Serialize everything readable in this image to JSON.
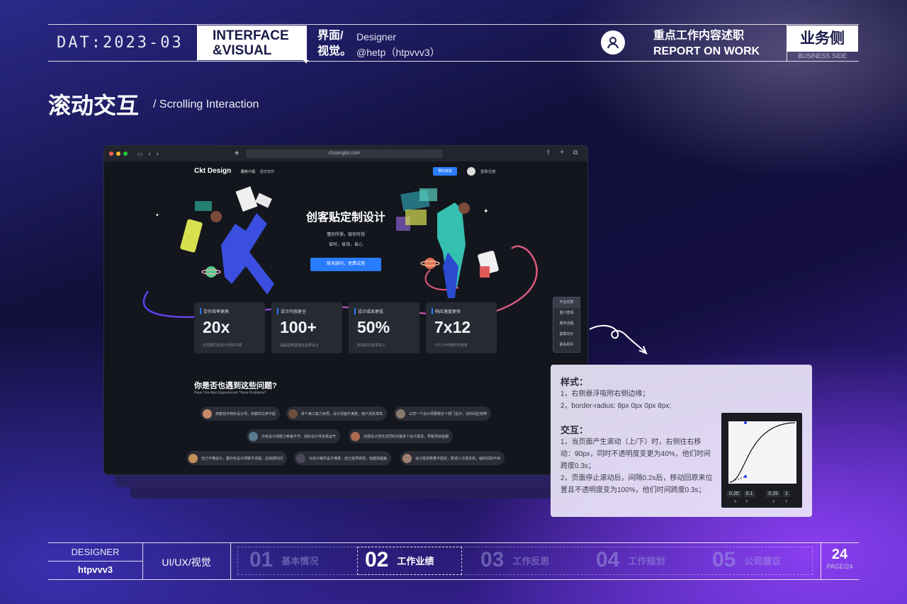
{
  "header": {
    "date": "DAT:2023-03",
    "section_en_1": "INTERFACE",
    "section_en_2": "&VISUAL",
    "section_cn_1": "界面/",
    "section_cn_2": "视觉。",
    "role": "Designer",
    "handle": "@hetp（htpvvv3）",
    "report_cn": "重点工作内容述职",
    "report_en": "REPORT ON WORK",
    "side_cn": "业务侧",
    "side_en": "BUSINESS SIDE"
  },
  "page_title": {
    "cn": "滚动交互",
    "en": "/ Scrolling Interaction"
  },
  "browser": {
    "url": "chuangkit.com",
    "logo": "Ckt Design",
    "nav": [
      "服务介绍",
      "服务案例"
    ],
    "cta": "预约体验",
    "login": "登录/注册",
    "hero_title": "创客贴定制设计",
    "hero_line1": "懂你所需，做你所想",
    "hero_line2": "省时，省钱，省心",
    "hero_button": "联系顾问，免费试用",
    "stats": [
      {
        "label": "交付效率更高",
        "value": "20x",
        "sub": "比招聘内部设计师快20倍"
      },
      {
        "label": "设计内容更全",
        "value": "100+",
        "sub": "涵盖品牌营销全品类设计"
      },
      {
        "label": "设计成本更低",
        "value": "50%",
        "sub": "削减设计成本投入"
      },
      {
        "label": "响应速度更快",
        "value": "7x12",
        "sub": "7X12小时随时可接单"
      }
    ],
    "problems_title": "你是否也遇到这些问题?",
    "problems_sub": "Have You Also Experienced These Problems?",
    "chips": [
      "高薪找不到好设计师，高薪的又养不起",
      "单个美工能力有限，设计页面不满意，用户流失率高",
      "公司一个设计师要做多个部门设计，没时间应变啊",
      "外包设计师能力参差不齐，找好设计师全靠运气",
      "内部设计师无法同时对接多个设计需求，导致项目延期",
      "自己不懂设计，跟外包设计师聊不清楚，还浪费时间",
      "对设计稿件品不满意，自己指导修改，但越改越差",
      "设计需求数量不固定，聘请人才成本高，临时间找不到"
    ],
    "side_nav": [
      "平台优势",
      "客户案例",
      "服务流程",
      "套餐定价",
      "联系顾问"
    ]
  },
  "note": {
    "style_title": "样式：",
    "style_lines": [
      "1，右侧悬浮吸附右侧边缘；",
      "2，border-radius: 8px 0px 0px 8px;"
    ],
    "interact_title": "交互：",
    "interact_lines": [
      "1，当页面产生滚动（上/下）时，右侧往右移",
      "动：90px，同时不透明度变更为40%，他们时间",
      "跨度0.3s；",
      "2，页面停止滚动后，间隔0.2s后，移动回原来位",
      "置且不透明度变为100%，他们时间跨度0.3s；"
    ],
    "curve_values": [
      "0.25",
      "0.1",
      "0.25",
      "1"
    ],
    "curve_axes": [
      "X",
      "Y",
      "X",
      "Y"
    ]
  },
  "footer": {
    "designer": "DESIGNER",
    "handle": "htpvvv3",
    "discipline": "UI/UX/视觉",
    "tabs": [
      {
        "num": "01",
        "label": "基本情况"
      },
      {
        "num": "02",
        "label": "工作业绩"
      },
      {
        "num": "03",
        "label": "工作反思"
      },
      {
        "num": "04",
        "label": "工作规划"
      },
      {
        "num": "05",
        "label": "公司建议"
      }
    ],
    "page_num": "24",
    "page_total": "PAGE/24"
  },
  "colors": {
    "accent": "#2a7cff",
    "brand_dark": "#1a1a4a"
  }
}
